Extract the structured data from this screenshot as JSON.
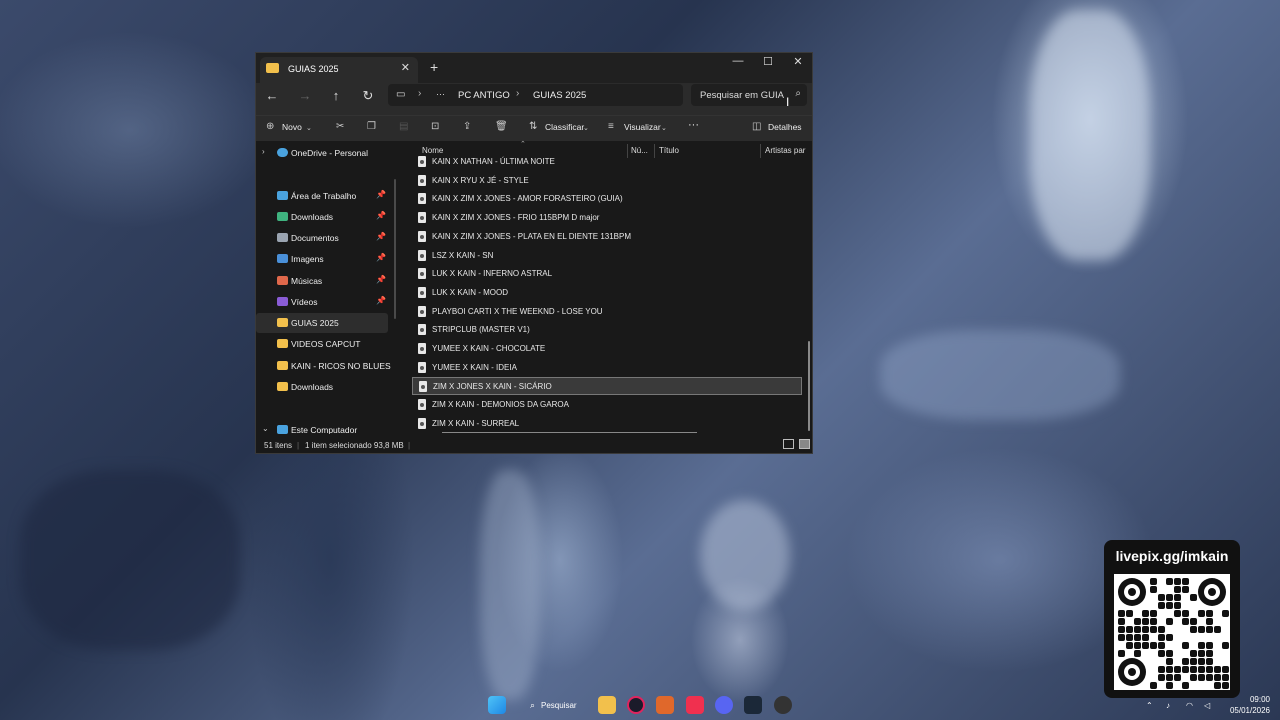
{
  "window": {
    "tab_title": "GUIAS 2025",
    "tab_close": "✕",
    "new_tab": "+",
    "controls": {
      "minimize": "—",
      "maximize": "☐",
      "close": "✕"
    }
  },
  "address": {
    "crumbs": [
      "PC ANTIGO",
      "GUIAS 2025"
    ],
    "overflow": "···",
    "search_placeholder": "Pesquisar em GUIA"
  },
  "toolbar": {
    "new_label": "Novo",
    "sort_label": "Classificar",
    "view_label": "Visualizar",
    "more_label": "···",
    "details_label": "Detalhes"
  },
  "sidebar": {
    "onedrive": "OneDrive - Personal",
    "items": [
      {
        "label": "Área de Trabalho",
        "pinned": true,
        "icon": "desktop-icon",
        "color": "#4aa3df"
      },
      {
        "label": "Downloads",
        "pinned": true,
        "icon": "download-icon",
        "color": "#3fb37f"
      },
      {
        "label": "Documentos",
        "pinned": true,
        "icon": "document-icon",
        "color": "#9aa4b1"
      },
      {
        "label": "Imagens",
        "pinned": true,
        "icon": "image-icon",
        "color": "#4a90d9"
      },
      {
        "label": "Músicas",
        "pinned": true,
        "icon": "music-icon",
        "color": "#e0684b"
      },
      {
        "label": "Vídeos",
        "pinned": true,
        "icon": "video-icon",
        "color": "#8a5cd6"
      },
      {
        "label": "GUIAS 2025",
        "pinned": false,
        "icon": "folder-icon",
        "color": "#f2c04c",
        "selected": true
      },
      {
        "label": "VIDEOS CAPCUT",
        "pinned": false,
        "icon": "folder-icon",
        "color": "#f2c04c"
      },
      {
        "label": "KAIN - RICOS NO BLUES",
        "pinned": false,
        "icon": "folder-icon",
        "color": "#f2c04c"
      },
      {
        "label": "Downloads",
        "pinned": false,
        "icon": "folder-icon",
        "color": "#f2c04c"
      }
    ],
    "this_pc": "Este Computador"
  },
  "columns": [
    "Nome",
    "Nú...",
    "Título",
    "Artistas par"
  ],
  "files": [
    "KAIN X NATHAN - ÚLTIMA NOITE",
    "KAIN X RYU X JÉ - STYLE",
    "KAIN X ZIM X JONES - AMOR FORASTEIRO (GUIA)",
    "KAIN X ZIM X JONES - FRIO 115BPM D major",
    "KAIN X ZIM X JONES - PLATA EN EL DIENTE 131BPM",
    "LSZ X KAIN - SN",
    "LUK X KAIN - INFERNO ASTRAL",
    "LUK X KAIN - MOOD",
    "PLAYBOI CARTI X THE WEEKND - LOSE YOU",
    "STRIPCLUB (MASTER V1)",
    "YUMEE X KAIN - CHOCOLATE",
    "YUMEE X KAIN - IDEIA",
    "ZIM X JONES X KAIN - SICÁRIO",
    "ZIM X KAIN - DEMONIOS DA GAROA",
    "ZIM X KAIN - SURREAL"
  ],
  "selected_file_index": 12,
  "status": {
    "count": "51 itens",
    "selection": "1 item selecionado  93,8 MB"
  },
  "stream": {
    "qr_title": "livepix.gg/imkain"
  },
  "taskbar": {
    "search_label": "Pesquisar",
    "clock_time": "09:00",
    "clock_date": "05/01/2026"
  }
}
